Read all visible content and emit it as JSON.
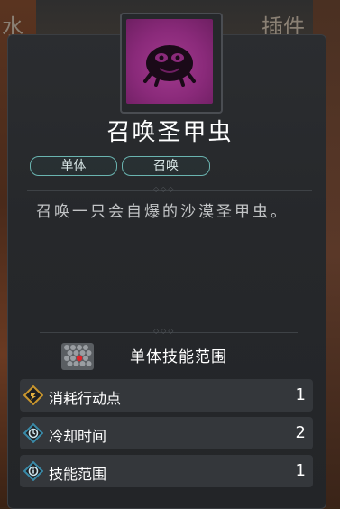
{
  "background": {
    "tab_left": "水",
    "tab_right": "插件"
  },
  "skill": {
    "icon": "scarab-beetle-icon",
    "name": "召唤圣甲虫",
    "tags": [
      "单体",
      "召唤"
    ],
    "description": "召唤一只会自爆的沙漠圣甲虫。"
  },
  "range": {
    "icon": "hex-grid-icon",
    "title": "单体技能范围"
  },
  "stats": [
    {
      "icon": "action-point-icon",
      "label": "消耗行动点",
      "value": "1"
    },
    {
      "icon": "cooldown-icon",
      "label": "冷却时间",
      "value": "2"
    },
    {
      "icon": "range-info-icon",
      "label": "技能范围",
      "value": "1"
    }
  ],
  "colors": {
    "icon_bg": "#8a2a7a",
    "tag_border": "#6ab4b0",
    "stat_icon": "#3a8aa8"
  }
}
